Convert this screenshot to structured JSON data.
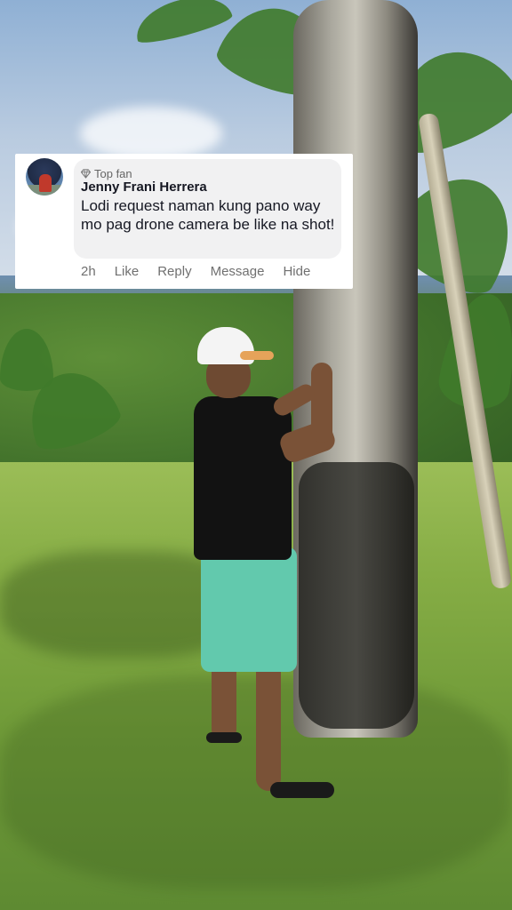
{
  "comment": {
    "badge": "Top fan",
    "badge_icon": "diamond-icon",
    "author": "Jenny Frani Herrera",
    "text": "Lodi request naman kung pano way mo pag drone camera be like na shot!",
    "time": "2h",
    "actions": {
      "like": "Like",
      "reply": "Reply",
      "message": "Message",
      "hide": "Hide"
    },
    "avatar_icon": "profile-photo"
  },
  "colors": {
    "card_background": "#ffffff",
    "bubble_background": "#f1f1f2",
    "author_text": "#161823",
    "meta_text": "#707070"
  }
}
